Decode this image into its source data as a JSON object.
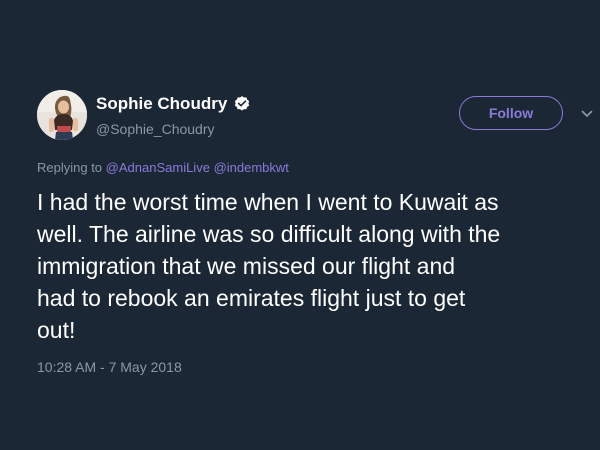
{
  "tweet": {
    "author": {
      "display_name": "Sophie Choudry",
      "handle": "@Sophie_Choudry",
      "verified": true,
      "avatar_icon": "avatar-photo"
    },
    "follow_label": "Follow",
    "more_icon": "chevron-down-icon",
    "reply_context": {
      "prefix": "Replying to",
      "mentions": [
        "@AdnanSamiLive",
        "@indembkwt"
      ]
    },
    "text": "I had the worst time when I went to Kuwait as\nwell. The airline was so difficult along with the\nimmigration that we missed our flight and\nhad to rebook an emirates flight just to get\nout!",
    "timestamp": "10:28 AM - 7 May 2018"
  },
  "colors": {
    "background": "#1b2735",
    "text_primary": "#ffffff",
    "text_secondary": "#8899a6",
    "accent": "#8b7bd8"
  }
}
